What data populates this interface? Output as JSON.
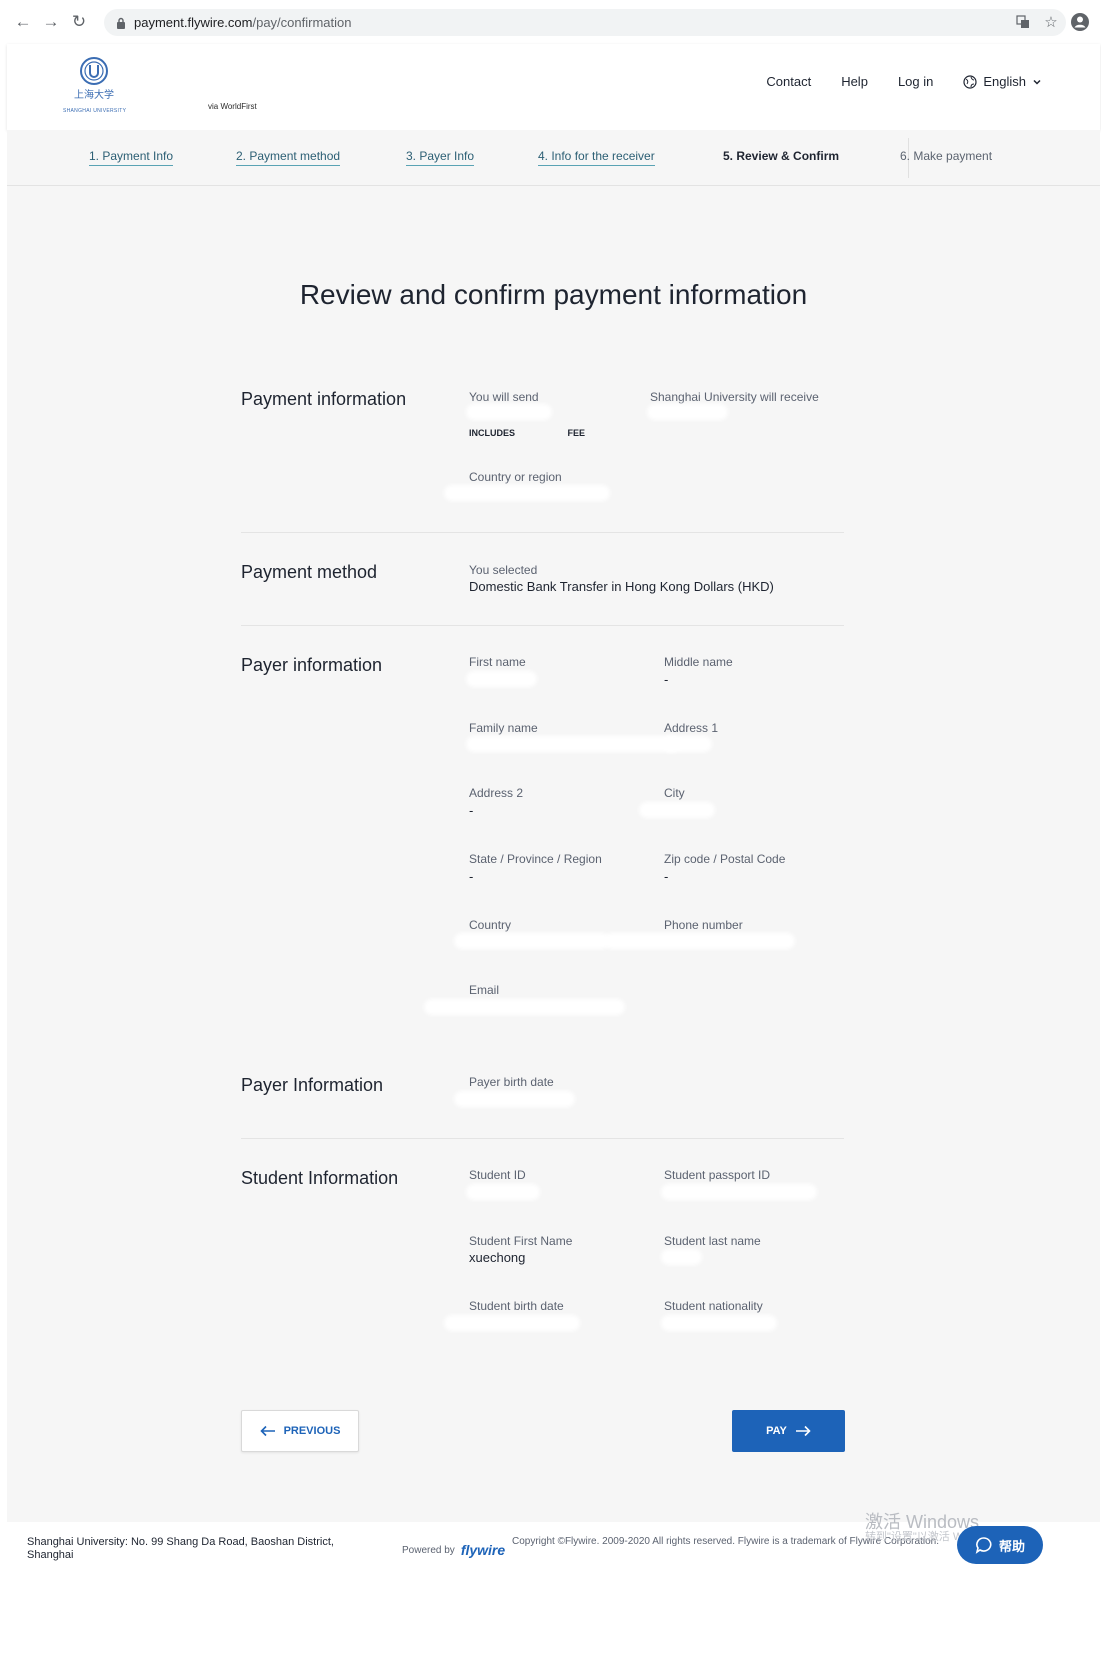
{
  "browser": {
    "url_domain": "payment.flywire.com",
    "url_path": "/pay/confirmation"
  },
  "header": {
    "logo_text": "上海大学",
    "logo_subtext": "SHANGHAI UNIVERSITY",
    "via": "via WorldFirst",
    "nav": [
      "Contact",
      "Help",
      "Log in"
    ],
    "language": "English"
  },
  "steps": [
    "1. Payment Info",
    "2. Payment method",
    "3. Payer Info",
    "4. Info for the receiver",
    "5. Review & Confirm",
    "6. Make payment"
  ],
  "title": "Review and confirm payment information",
  "payment_info": {
    "heading": "Payment information",
    "send_label": "You will send",
    "includes_label": "INCLUDES",
    "fee_label": "FEE",
    "receive_label": "Shanghai University will receive",
    "country_label": "Country or region"
  },
  "payment_method": {
    "heading": "Payment method",
    "selected_label": "You selected",
    "selected_value": "Domestic Bank Transfer in Hong Kong Dollars (HKD)"
  },
  "payer": {
    "heading": "Payer information",
    "first_name_label": "First name",
    "middle_name_label": "Middle name",
    "middle_name_value": "-",
    "family_name_label": "Family name",
    "address1_label": "Address 1",
    "address2_label": "Address 2",
    "address2_value": "-",
    "city_label": "City",
    "state_label": "State / Province / Region",
    "state_value": "-",
    "zip_label": "Zip code / Postal Code",
    "zip_value": "-",
    "country_label": "Country",
    "phone_label": "Phone number",
    "email_label": "Email"
  },
  "payer_extra": {
    "heading": "Payer Information",
    "birth_label": "Payer birth date"
  },
  "student": {
    "heading": "Student Information",
    "id_label": "Student ID",
    "passport_label": "Student passport ID",
    "first_name_label": "Student First Name",
    "first_name_value": "xuechong",
    "last_name_label": "Student last name",
    "birth_label": "Student birth date",
    "nationality_label": "Student nationality"
  },
  "buttons": {
    "previous": "PREVIOUS",
    "pay": "PAY"
  },
  "footer": {
    "address": "Shanghai University: No. 99 Shang Da Road, Baoshan District, Shanghai",
    "powered_by": "Powered by",
    "flywire": "flywire",
    "copyright": "Copyright ©Flywire. 2009-2020 All rights reserved. Flywire is a trademark of Flywire Corporation.",
    "watermark": "激活 Windows",
    "watermark_sub": "转到\"设置\"以激活 Windows",
    "help": "帮助"
  },
  "colors": {
    "accent": "#1d63b8",
    "step_underline": "#5aa3b4",
    "page_bg": "#f6f6f6"
  }
}
